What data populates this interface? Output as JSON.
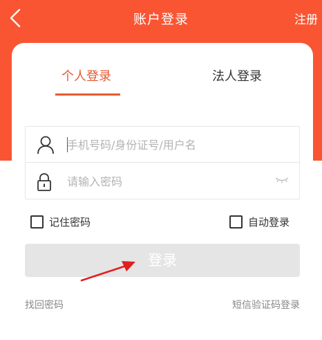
{
  "header": {
    "title": "账户登录",
    "register_label": "注册"
  },
  "tabs": [
    {
      "label": "个人登录",
      "active": true
    },
    {
      "label": "法人登录",
      "active": false
    }
  ],
  "form": {
    "username_placeholder": "手机号码/身份证号/用户名",
    "username_value": "",
    "password_placeholder": "请输入密码",
    "password_value": ""
  },
  "options": {
    "remember_label": "记住密码",
    "remember_checked": false,
    "auto_login_label": "自动登录",
    "auto_login_checked": false
  },
  "login_button_label": "登录",
  "links": {
    "forgot_password": "找回密码",
    "sms_login": "短信验证码登录"
  },
  "colors": {
    "brand": "#fa5533",
    "accent": "#e35a33",
    "disabled_button": "#e5e5e5",
    "arrow": "#e02020"
  },
  "icons": {
    "back": "chevron-left-icon",
    "user": "user-icon",
    "lock": "lock-icon",
    "password_visibility": "eye-closed-icon",
    "annotation": "red-arrow-icon"
  }
}
